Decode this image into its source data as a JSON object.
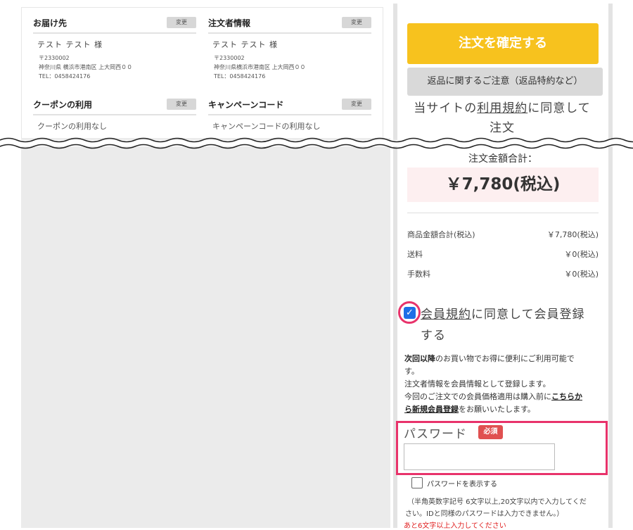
{
  "delivery": {
    "title": "お届け先",
    "change": "変更",
    "name": "テスト テスト 様",
    "postal": "〒2330002",
    "address": "神奈川県 横浜市港南区 上大岡西００",
    "tel": "TEL：0458424176"
  },
  "orderer": {
    "title": "注文者情報",
    "change": "変更",
    "name": "テスト テスト 様",
    "postal": "〒2330002",
    "address": "神奈川県横浜市港南区 上大岡西００",
    "tel": "TEL：0458424176"
  },
  "coupon": {
    "title": "クーポンの利用",
    "change": "変更",
    "value": "クーポンの利用なし"
  },
  "campaign": {
    "title": "キャンペーンコード",
    "change": "変更",
    "value": "キャンペーンコードの利用なし"
  },
  "checkout": {
    "confirm_label": "注文を確定する",
    "return_label": "返品に関するご注意（返品特約など）",
    "agree_prefix": "当サイトの",
    "agree_link": "利用規約",
    "agree_suffix": "に同意して",
    "agree_line2": "注文"
  },
  "totals": {
    "label": "注文金額合計：",
    "amount": "￥7,780(税込)",
    "rows": [
      {
        "label": "商品金額合計(税込)",
        "value": "￥7,780(税込)"
      },
      {
        "label": "送料",
        "value": "￥0(税込)"
      },
      {
        "label": "手数料",
        "value": "￥0(税込)"
      }
    ]
  },
  "register": {
    "checked": true,
    "link": "会員規約",
    "text1": "に同意して会員登録",
    "text2": "する",
    "info_bold": "次回以降",
    "info1": "のお買い物でお得に便利にご利用可能で",
    "info2": "す。",
    "info3": "注文者情報を会員情報として登録します。",
    "info4": "今回のご注文での会員価格適用は購入前に",
    "info_link1": "こちらか",
    "info_link2": "ら新規会員登録",
    "info5": "をお願いいたします。"
  },
  "password": {
    "label": "パスワード",
    "required": "必須",
    "value": "",
    "show_label": "パスワードを表示する",
    "note1": "（半角英数字記号 6文字以上,20文字以内で入力してくだ",
    "note2": "さい。IDと同様のパスワードは入力できません。）",
    "error": "あと6文字以上入力してください"
  },
  "colors": {
    "confirm": "#f7c21e",
    "highlight": "#e8336b",
    "checkbox": "#1e6fe6",
    "badge": "#e05050",
    "total_bg": "#fdeff0"
  }
}
